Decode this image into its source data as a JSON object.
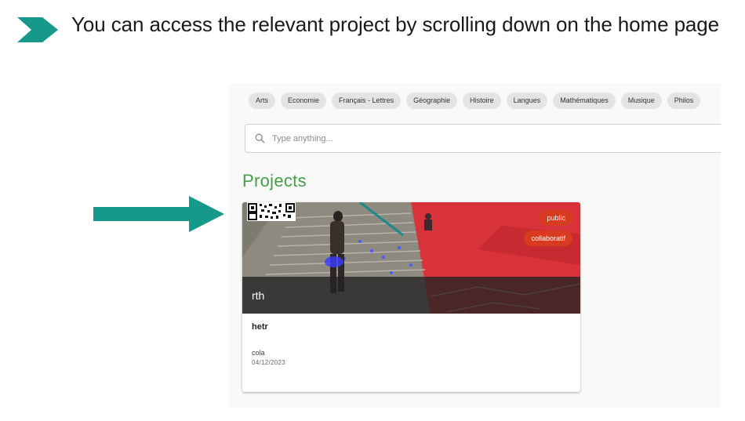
{
  "slide": {
    "title": "You can access the relevant project by scrolling down on the home page"
  },
  "colors": {
    "accent_teal": "#16998b",
    "projects_green": "#43a047",
    "badge_red": "#d83b1f"
  },
  "icons": {
    "bullet": "chevron-right-icon",
    "pointer": "arrow-right-icon",
    "search": "search-icon"
  },
  "app": {
    "categories": [
      "Arts",
      "Economie",
      "Français - Lettres",
      "Géographie",
      "Histoire",
      "Langues",
      "Mathématiques",
      "Musique",
      "Philos"
    ],
    "search": {
      "placeholder": "Type anything..."
    },
    "projects_heading": "Projects",
    "project_card": {
      "overlay_title": "rth",
      "badges": [
        "public",
        "collaboratif"
      ],
      "title": "hetr",
      "owner": "cola",
      "date": "04/12/2023"
    }
  }
}
